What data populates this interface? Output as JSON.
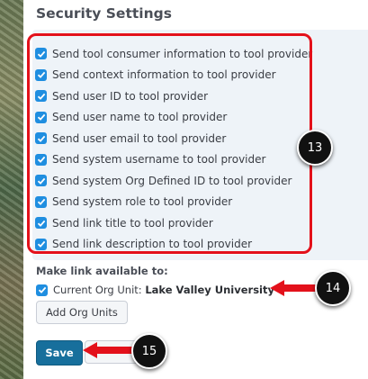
{
  "security_settings": {
    "heading": "Security Settings",
    "options": [
      {
        "label": "Send tool consumer information to tool provider",
        "checked": true
      },
      {
        "label": "Send context information to tool provider",
        "checked": true
      },
      {
        "label": "Send user ID to tool provider",
        "checked": true
      },
      {
        "label": "Send user name to tool provider",
        "checked": true
      },
      {
        "label": "Send user email to tool provider",
        "checked": true
      },
      {
        "label": "Send system username to tool provider",
        "checked": true
      },
      {
        "label": "Send system Org Defined ID to tool provider",
        "checked": true
      },
      {
        "label": "Send system role to tool provider",
        "checked": true
      },
      {
        "label": "Send link title to tool provider",
        "checked": true
      },
      {
        "label": "Send link description to tool provider",
        "checked": true
      }
    ]
  },
  "availability": {
    "heading": "Make link available to:",
    "current_org_label": "Current Org Unit:",
    "current_org_value": "Lake Valley University",
    "current_org_checked": true,
    "add_org_units_label": "Add Org Units"
  },
  "actions": {
    "save_label": "Save",
    "cancel_label": ""
  },
  "callouts": {
    "step_13": "13",
    "step_14": "14",
    "step_15": "15"
  },
  "colors": {
    "accent_red": "#e3111b",
    "checkbox_blue": "#1f8ee0",
    "save_blue": "#176f9c",
    "options_bg": "#eef3f8"
  }
}
